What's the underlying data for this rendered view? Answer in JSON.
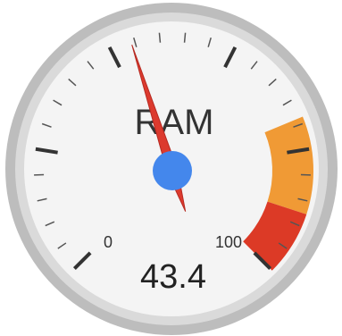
{
  "chart_data": {
    "type": "gauge",
    "label": "RAM",
    "value": 43.4,
    "value_text": "43.4",
    "min": 0,
    "max": 100,
    "min_label": "0",
    "max_label": "100",
    "major_ticks": [
      0,
      20,
      40,
      60,
      80,
      100
    ],
    "minor_ticks_per_major": 4,
    "bands": [
      {
        "name": "yellow",
        "from": 75,
        "to": 90,
        "color": "#f09a35"
      },
      {
        "name": "red",
        "from": 90,
        "to": 100,
        "color": "#dc3a26"
      }
    ],
    "colors": {
      "needle": "#dc3a2e",
      "needle_edge": "#b62a22",
      "hub": "#4487ec",
      "face": "#f4f4f4",
      "rim_outer": "#bdbdbd",
      "rim_inner": "#dadada",
      "tick": "#333333",
      "text": "#333333"
    }
  }
}
